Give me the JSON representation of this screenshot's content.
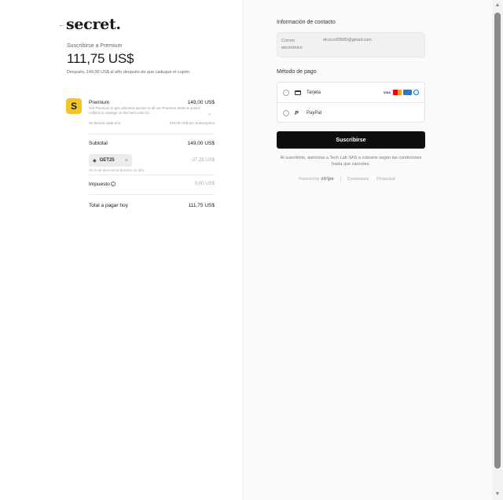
{
  "brand": {
    "name": "secret.",
    "back_icon": "arrow-left-icon"
  },
  "summary": {
    "subscribe_label": "Suscribirse a Premium",
    "price": "111,75 US$",
    "after_note": "Después, 149,00 US$ al año después de que caduque el cupón"
  },
  "product": {
    "icon_letter": "S",
    "icon_color": "#f2c62a",
    "name": "Premium",
    "price": "149,00 US$",
    "description": "Get Premium to get unlimited access to all our Premium deals & unlock millions in savings on the best tools for...",
    "billing_left": "Se factura cada año",
    "billing_right": "149,00 US$ por Subscription"
  },
  "totals": {
    "subtotal_label": "Subtotal",
    "subtotal_value": "149,00 US$",
    "coupon_code": "GET25",
    "coupon_discount": "-37,25 US$",
    "coupon_note": "25 % de descuento durante un año",
    "tax_label": "Impuesto",
    "tax_value": "0,00 US$",
    "total_label": "Total a pagar hoy",
    "total_value": "111,75 US$"
  },
  "contact": {
    "title": "Información de contacto",
    "email_label": "Correo electrónico",
    "email_value": "elcoco30500@gmail.com"
  },
  "payment": {
    "title": "Método de pago",
    "options": [
      {
        "label": "Tarjeta",
        "icon": "credit-card-icon"
      },
      {
        "label": "PayPal",
        "icon": "paypal-icon"
      }
    ],
    "card_brands": [
      "VISA",
      "Mastercard",
      "Amex",
      "Diners"
    ]
  },
  "actions": {
    "subscribe_button": "Suscribirse",
    "legal_note": "Al suscribirte, autorizas a Tech Lab SAS a cobrarte según las condiciones hasta que canceles."
  },
  "footer": {
    "powered_by": "Powered by",
    "stripe": "stripe",
    "terms": "Condiciones",
    "privacy": "Privacidad"
  }
}
